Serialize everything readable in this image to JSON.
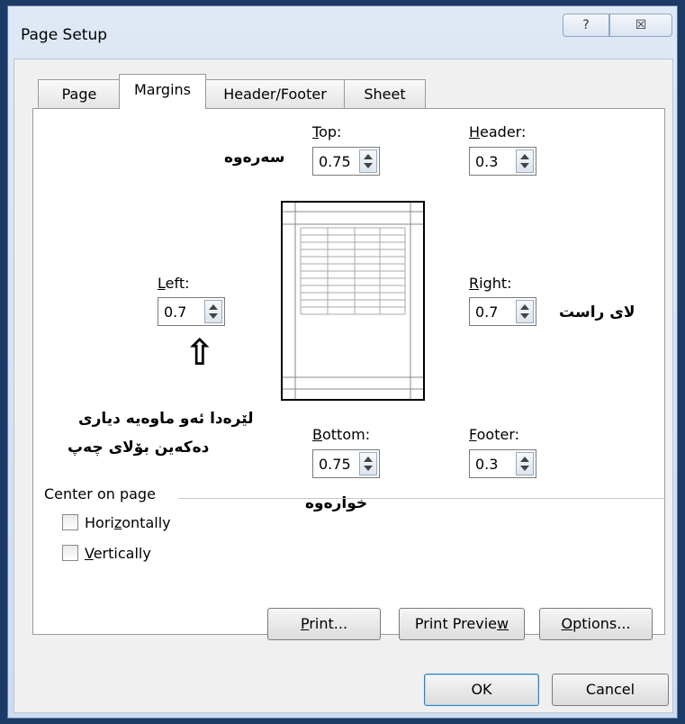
{
  "window": {
    "title": "Page Setup",
    "help_glyph": "?",
    "close_glyph": "☒"
  },
  "tabs": [
    {
      "label": "Page"
    },
    {
      "label": "Margins"
    },
    {
      "label": "Header/Footer"
    },
    {
      "label": "Sheet"
    }
  ],
  "margins": {
    "top": {
      "label": "Top:",
      "value": "0.75"
    },
    "header": {
      "label": "Header:",
      "value": "0.3"
    },
    "left": {
      "label": "Left:",
      "value": "0.7"
    },
    "right": {
      "label": "Right:",
      "value": "0.7"
    },
    "bottom": {
      "label": "Bottom:",
      "value": "0.75"
    },
    "footer": {
      "label": "Footer:",
      "value": "0.3"
    }
  },
  "annotations": {
    "top": "سەرەوە",
    "right": "لای راست",
    "left_line1": "لێرەدا ئەو ماوەیە دیاری",
    "left_line2": "دەکەین بۆلای چەپ",
    "bottom": "خوارەوە",
    "arrow_glyph": "⇧"
  },
  "center_on_page": {
    "label": "Center on page",
    "horizontally": {
      "label": "Horizontally",
      "checked": false
    },
    "vertically": {
      "label": "Vertically",
      "checked": false
    }
  },
  "buttons": {
    "print": "Print...",
    "print_preview": "Print Preview",
    "options": "Options...",
    "ok": "OK",
    "cancel": "Cancel"
  }
}
